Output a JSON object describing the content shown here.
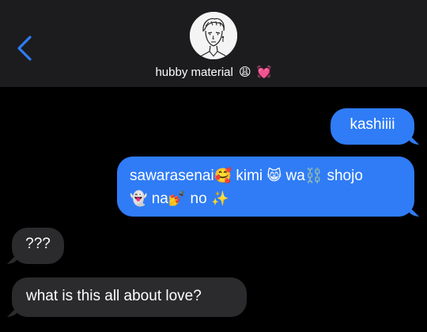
{
  "header": {
    "contact_name": "hubby material",
    "name_emojis": [
      "😩",
      "💓"
    ],
    "back_icon": "chevron-left-icon",
    "accent_color": "#2f7cf6"
  },
  "messages": [
    {
      "direction": "sent",
      "text": "kashiiii"
    },
    {
      "direction": "sent",
      "segments": [
        "sawarasenai",
        "🥰",
        " kimi ",
        "😸",
        " wa",
        "⛓️",
        " shojo ",
        "👻",
        " na",
        "💅",
        " no ",
        "✨"
      ]
    },
    {
      "direction": "received",
      "text": "???"
    },
    {
      "direction": "received",
      "text": "what is this all about love?"
    }
  ],
  "colors": {
    "sent_bubble": "#2f7cf6",
    "received_bubble": "#2b2b2d",
    "header_bg": "#1c1c1e",
    "background": "#000000"
  }
}
